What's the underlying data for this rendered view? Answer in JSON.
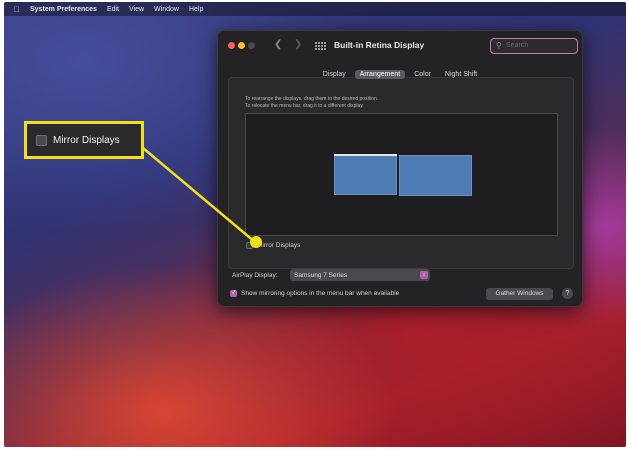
{
  "menubar": {
    "apple_icon": "apple-icon",
    "app_name": "System Preferences",
    "items": [
      "Edit",
      "View",
      "Window",
      "Help"
    ]
  },
  "window": {
    "title": "Built-in Retina Display",
    "back_icon": "chevron-left-icon",
    "forward_icon": "chevron-right-icon",
    "grid_icon": "grid-icon",
    "search": {
      "icon": "search-icon",
      "placeholder": "Search"
    }
  },
  "tabs": [
    {
      "label": "Display",
      "active": false
    },
    {
      "label": "Arrangement",
      "active": true
    },
    {
      "label": "Color",
      "active": false
    },
    {
      "label": "Night Shift",
      "active": false
    }
  ],
  "arrangement": {
    "instructions_line1": "To rearrange the displays, drag them to the desired position.",
    "instructions_line2": "To relocate the menu bar, drag it to a different display.",
    "mirror_label": "Mirror Displays",
    "mirror_checked": false
  },
  "airplay": {
    "label": "AirPlay Display:",
    "selected": "Samsung 7 Series"
  },
  "mirroring_option": {
    "label": "Show mirroring options in the menu bar when available",
    "checked": true
  },
  "buttons": {
    "gather": "Gather Windows",
    "help": "?"
  },
  "callout": {
    "label": "Mirror Displays",
    "color": "#f2e01a"
  },
  "colors": {
    "accent": "#b45fa8",
    "display_blue": "#4f7db3",
    "window_bg": "#232325"
  }
}
